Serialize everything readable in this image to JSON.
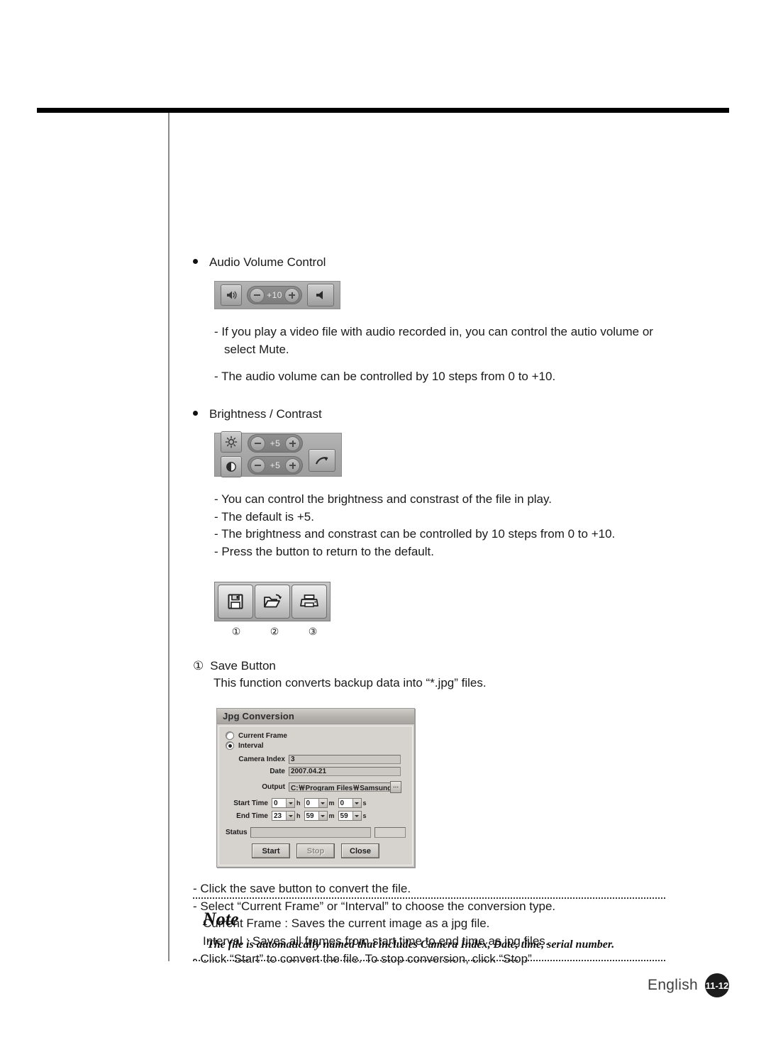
{
  "page": {
    "footer_language": "English",
    "page_number": "11-12"
  },
  "sections": {
    "audio": {
      "heading": "Audio Volume Control",
      "widget": {
        "speaker_value": "+10",
        "minus_label": "-",
        "plus_label": "+"
      },
      "lines": [
        "- If you play a video file with audio recorded in, you can control the autio volume or",
        "select Mute.",
        "- The audio volume can be controlled by 10 steps from 0 to +10."
      ]
    },
    "brightness": {
      "heading": "Brightness / Contrast",
      "widget": {
        "brightness_value": "+5",
        "contrast_value": "+5"
      },
      "lines": [
        "- You can control the brightness and constrast of the file in play.",
        "- The default is +5.",
        "- The brightness and constrast can be controlled by 10 steps from 0 to +10.",
        "- Press the button to return to the default."
      ]
    },
    "toolbar": {
      "buttons": [
        {
          "icon": "save-floppy-icon",
          "number": "①"
        },
        {
          "icon": "open-folder-icon",
          "number": "②"
        },
        {
          "icon": "print-printer-icon",
          "number": "③"
        }
      ]
    },
    "save_button": {
      "number": "①",
      "heading": "Save Button",
      "description": "This function converts backup data into “*.jpg” files."
    },
    "dialog": {
      "title": "Jpg Conversion",
      "radios": [
        {
          "label": "Current Frame",
          "selected": false
        },
        {
          "label": "Interval",
          "selected": true
        }
      ],
      "fields": [
        {
          "label": "Camera Index",
          "value": "3"
        },
        {
          "label": "Date",
          "value": "2007.04.21"
        }
      ],
      "output": {
        "label": "Output",
        "value": "C:￦Program Files￦Samsung￦Sma",
        "browse_label": "⋯"
      },
      "start_time": {
        "label": "Start Time",
        "hour": "0",
        "minute": "0",
        "second": "0"
      },
      "end_time": {
        "label": "End Time",
        "hour": "23",
        "minute": "59",
        "second": "59"
      },
      "units": {
        "hour": "h",
        "minute": "m",
        "second": "s"
      },
      "status_label": "Status",
      "status_value": "",
      "status_percent": "",
      "buttons": [
        {
          "label": "Start",
          "enabled": true
        },
        {
          "label": "Stop",
          "enabled": false
        },
        {
          "label": "Close",
          "enabled": true
        }
      ]
    },
    "dialog_notes": [
      "- Click the save button to convert the file.",
      "- Select “Current Frame” or “Interval” to choose the conversion type.",
      "Current Frame : Saves the current image as a jpg file.",
      "Interval : Saves all frames from start time to end time as jpg files.",
      "- Click “Start” to convert the file. To stop conversion, click “Stop”"
    ]
  },
  "note": {
    "title": "Note",
    "text": "The file is automatically named that includes Camera Index, Date, time, serial number."
  }
}
